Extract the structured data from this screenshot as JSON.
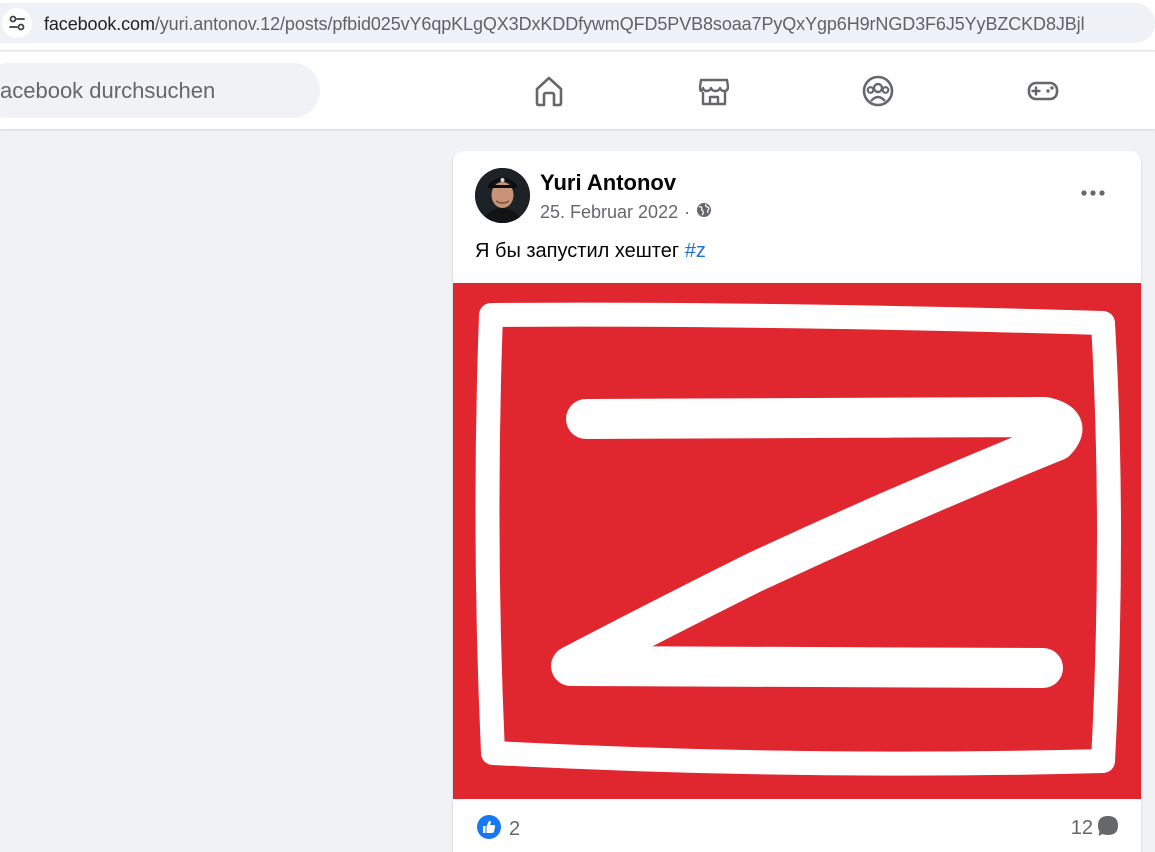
{
  "browser": {
    "url_host": "facebook.com",
    "url_path": "/yuri.antonov.12/posts/pfbid025vY6qpKLgQX3DxKDDfywmQFD5PVB8soaa7PyQxYgp6H9rNGD3F6J5YyBZCKD8JBjl"
  },
  "topbar": {
    "search_placeholder": "acebook durchsuchen",
    "nav_icons": [
      "home-icon",
      "marketplace-icon",
      "groups-icon",
      "gaming-icon"
    ]
  },
  "post": {
    "author": "Yuri Antonov",
    "date": "25. Februar 2022",
    "separator": "·",
    "text": "Я бы запустил хештег ",
    "hashtag": "#z",
    "image_background": "#e0262e",
    "reaction_count": "2",
    "comment_count": "12"
  },
  "colors": {
    "link_blue": "#216fdb",
    "like_blue": "#1877f2",
    "page_bg": "#f0f2f5"
  }
}
